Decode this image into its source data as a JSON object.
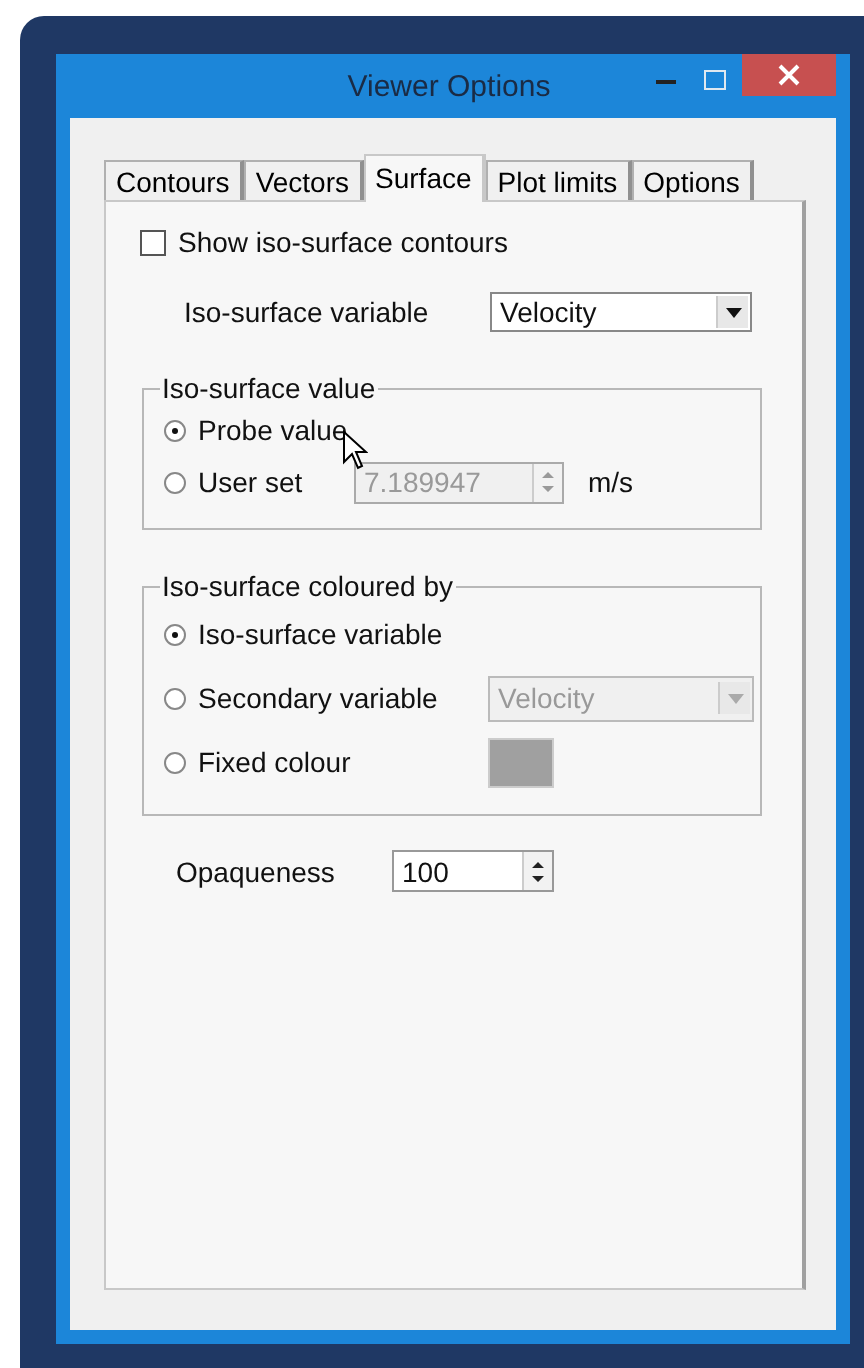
{
  "window": {
    "title": "Viewer Options"
  },
  "tabs": [
    {
      "label": "Contours",
      "selected": false
    },
    {
      "label": "Vectors",
      "selected": false
    },
    {
      "label": "Surface",
      "selected": true
    },
    {
      "label": "Plot limits",
      "selected": false
    },
    {
      "label": "Options",
      "selected": false
    }
  ],
  "show_contours": {
    "label": "Show iso-surface contours",
    "checked": false
  },
  "iso_variable": {
    "label": "Iso-surface variable",
    "value": "Velocity"
  },
  "iso_value": {
    "title": "Iso-surface value",
    "options": [
      {
        "label": "Probe value",
        "selected": true
      },
      {
        "label": "User set",
        "selected": false
      }
    ],
    "user_value": {
      "value": "7.189947",
      "disabled": true
    },
    "unit": "m/s"
  },
  "coloured_by": {
    "title": "Iso-surface coloured by",
    "options": [
      {
        "kind": "plain",
        "label": "Iso-surface variable",
        "selected": true
      },
      {
        "kind": "dropdown",
        "label": "Secondary variable",
        "selected": false,
        "value": "Velocity",
        "disabled": true
      },
      {
        "kind": "swatch",
        "label": "Fixed colour",
        "selected": false,
        "color": "#a0a0a0"
      }
    ]
  },
  "opaqueness": {
    "label": "Opaqueness",
    "value": "100"
  }
}
